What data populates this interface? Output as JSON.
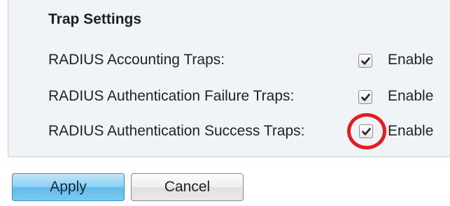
{
  "trap_settings": {
    "title": "Trap Settings",
    "rows": [
      {
        "label": "RADIUS Accounting Traps:",
        "checked": true,
        "option_label": "Enable"
      },
      {
        "label": "RADIUS Authentication Failure Traps:",
        "checked": true,
        "option_label": "Enable"
      },
      {
        "label": "RADIUS Authentication Success Traps:",
        "checked": true,
        "option_label": "Enable"
      }
    ]
  },
  "buttons": {
    "apply_label": "Apply",
    "cancel_label": "Cancel"
  },
  "colors": {
    "highlight_ring": "#e41b23",
    "panel_background": "#f1f4f7",
    "apply_button": "#8fd0f3"
  },
  "icons": {
    "checkmark": "checkmark-icon"
  }
}
